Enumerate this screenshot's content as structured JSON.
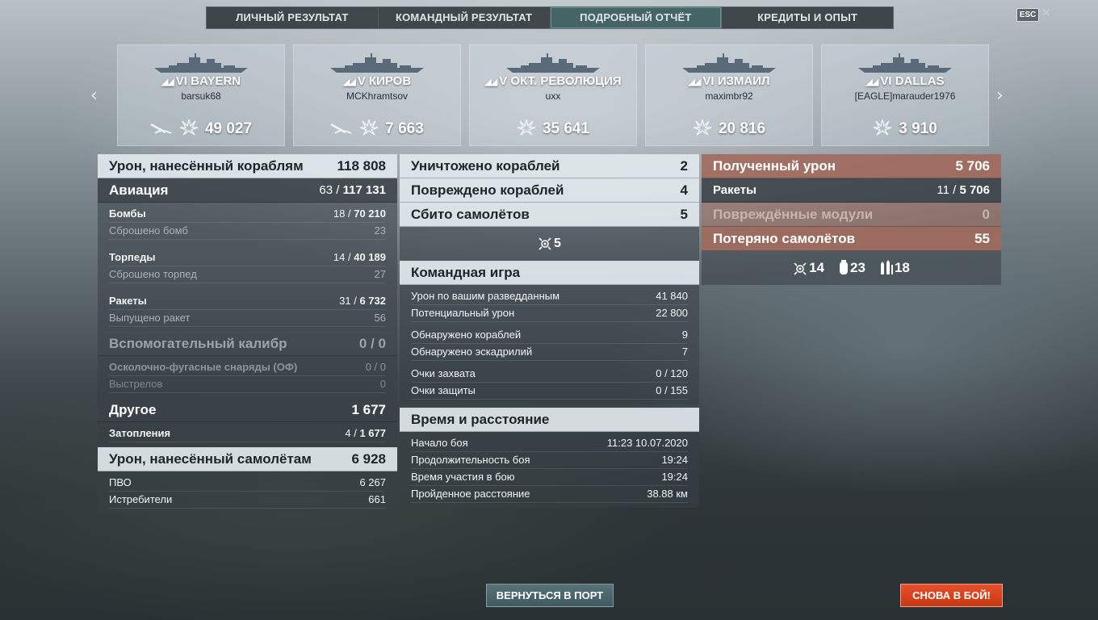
{
  "tabs": [
    "ЛИЧНЫЙ РЕЗУЛЬТАТ",
    "КОМАНДНЫЙ РЕЗУЛЬТАТ",
    "ПОДРОБНЫЙ ОТЧЁТ",
    "КРЕДИТЫ И ОПЫТ"
  ],
  "active_tab": "ПОДРОБНЫЙ ОТЧЁТ",
  "esc_label": "ESC",
  "close_glyph": "✕",
  "nav": {
    "prev": "‹",
    "next": "›"
  },
  "ships": [
    {
      "tier": "VI",
      "name": "BAYERN",
      "player": "barsuk68",
      "damage": "49 027",
      "has_torpedo_icon": true
    },
    {
      "tier": "V",
      "name": "КИРОВ",
      "player": "MCKhramtsov",
      "damage": "7 663",
      "has_torpedo_icon": true
    },
    {
      "tier": "V",
      "name": "ОКТ. РЕВОЛЮЦИЯ",
      "player": "uxx",
      "damage": "35 641",
      "has_torpedo_icon": false
    },
    {
      "tier": "VI",
      "name": "ИЗМАИЛ",
      "player": "maximbr92",
      "damage": "20 816",
      "has_torpedo_icon": false
    },
    {
      "tier": "VI",
      "name": "DALLAS",
      "player": "[EAGLE]marauder1976",
      "damage": "3 910",
      "has_torpedo_icon": false
    }
  ],
  "left": {
    "ships_damage": {
      "label": "Урон, нанесённый кораблям",
      "value": "118 808"
    },
    "aviation": {
      "label": "Авиация",
      "hits": "63",
      "value": "117 131"
    },
    "bombs": {
      "label": "Бомбы",
      "hits": "18",
      "value": "70 210"
    },
    "bombs_dropped": {
      "label": "Сброшено бомб",
      "value": "23"
    },
    "torpedoes": {
      "label": "Торпеды",
      "hits": "14",
      "value": "40 189"
    },
    "torpedoes_dropped": {
      "label": "Сброшено торпед",
      "value": "27"
    },
    "rockets": {
      "label": "Ракеты",
      "hits": "31",
      "value": "6 732"
    },
    "rockets_fired": {
      "label": "Выпущено ракет",
      "value": "56"
    },
    "secondary": {
      "label": "Вспомогательный калибр",
      "value": "0 / 0"
    },
    "he_shells": {
      "label": "Осколочно-фугасные снаряды (ОФ)",
      "value": "0 / 0"
    },
    "shots": {
      "label": "Выстрелов",
      "value": "0"
    },
    "other": {
      "label": "Другое",
      "value": "1 677"
    },
    "flooding": {
      "label": "Затопления",
      "hits": "4",
      "value": "1 677"
    },
    "planes_damage": {
      "label": "Урон, нанесённый самолётам",
      "value": "6 928"
    },
    "aa": {
      "label": "ПВО",
      "value": "6 267"
    },
    "fighters": {
      "label": "Истребители",
      "value": "661"
    }
  },
  "middle": {
    "destroyed": {
      "label": "Уничтожено кораблей",
      "value": "2"
    },
    "damaged": {
      "label": "Повреждено кораблей",
      "value": "4"
    },
    "shot_down": {
      "label": "Сбито самолётов",
      "value": "5"
    },
    "shot_down_icon": {
      "icon": "plane-shot-icon",
      "value": "5"
    },
    "teamplay": {
      "title": "Командная игра",
      "rows": [
        {
          "label": "Урон по вашим разведданным",
          "value": "41 840"
        },
        {
          "label": "Потенциальный урон",
          "value": "22 800"
        },
        {
          "label": "Обнаружено кораблей",
          "value": "9"
        },
        {
          "label": "Обнаружено эскадрилий",
          "value": "7"
        },
        {
          "label": "Очки захвата",
          "value": "0 / 120"
        },
        {
          "label": "Очки защиты",
          "value": "0 / 155"
        }
      ]
    },
    "time": {
      "title": "Время и расстояние",
      "rows": [
        {
          "label": "Начало боя",
          "value": "11:23  10.07.2020"
        },
        {
          "label": "Продолжительность боя",
          "value": "19:24"
        },
        {
          "label": "Время участия в бою",
          "value": "19:24"
        },
        {
          "label": "Пройденное расстояние",
          "value": "38.88 км"
        }
      ]
    }
  },
  "right": {
    "received": {
      "label": "Полученный урон",
      "value": "5 706"
    },
    "rockets": {
      "label": "Ракеты",
      "hits": "11",
      "value": "5 706"
    },
    "modules": {
      "label": "Повреждённые модули",
      "value": "0"
    },
    "planes_lost": {
      "label": "Потеряно самолётов",
      "value": "55"
    },
    "icons": [
      {
        "icon": "plane-shot-icon",
        "value": "14"
      },
      {
        "icon": "bomb-icon",
        "value": "23"
      },
      {
        "icon": "rockets-icon",
        "value": "18"
      }
    ]
  },
  "buttons": {
    "port": "ВЕРНУТЬСЯ В ПОРТ",
    "battle": "СНОВА В БОЙ!"
  },
  "colors": {
    "accent_red": "#d9441c",
    "received_hdr": "#a0695a",
    "active_tab": "#466e6e"
  }
}
